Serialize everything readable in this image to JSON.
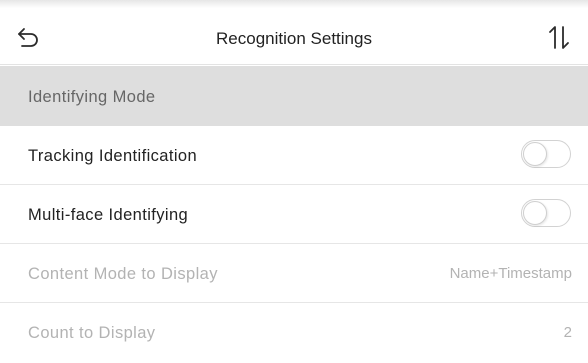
{
  "header": {
    "back_icon": "back-arrow-icon",
    "title": "Recognition Settings",
    "sort_icon": "sort-arrows-icon"
  },
  "section": {
    "label": "Identifying Mode"
  },
  "rows": [
    {
      "label": "Tracking Identification",
      "control": "toggle",
      "enabled": false
    },
    {
      "label": "Multi-face Identifying",
      "control": "toggle",
      "enabled": false
    },
    {
      "label": "Content Mode to Display",
      "value": "Name+Timestamp",
      "disabled": true
    },
    {
      "label": "Count to Display",
      "value": "2",
      "disabled": true
    }
  ],
  "colors": {
    "section_bg": "#dedede",
    "text": "#222222",
    "disabled_text": "#b3b3b3"
  }
}
